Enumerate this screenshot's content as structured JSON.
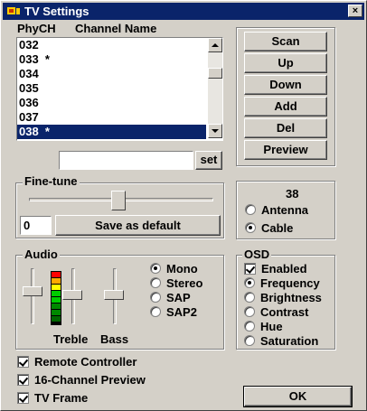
{
  "window": {
    "title": "TV Settings",
    "close": "×"
  },
  "channels": {
    "headers": {
      "phy": "PhyCH",
      "name": "Channel Name"
    },
    "items": [
      "032",
      "033  *",
      "034",
      "035",
      "036",
      "037",
      "038  *"
    ],
    "selected_index": 6,
    "name_input": "",
    "set_label": "set"
  },
  "actions": {
    "scan": "Scan",
    "up": "Up",
    "down": "Down",
    "add": "Add",
    "del": "Del",
    "preview": "Preview"
  },
  "finetune": {
    "legend": "Fine-tune",
    "value": "0",
    "save_default": "Save as default"
  },
  "source": {
    "channel": "38",
    "antenna": "Antenna",
    "cable": "Cable",
    "selected": "Cable"
  },
  "audio": {
    "legend": "Audio",
    "treble": "Treble",
    "bass": "Bass",
    "modes": [
      "Mono",
      "Stereo",
      "SAP",
      "SAP2"
    ],
    "selected_mode": "Mono",
    "meter_colors": [
      "#ff0000",
      "#ffaa00",
      "#ffff00",
      "#00cc00",
      "#00cc00",
      "#008800",
      "#008800",
      "#006600"
    ]
  },
  "osd": {
    "legend": "OSD",
    "enabled": "Enabled",
    "enabled_checked": true,
    "options": [
      "Frequency",
      "Brightness",
      "Contrast",
      "Hue",
      "Saturation"
    ],
    "selected": "Frequency"
  },
  "options": {
    "remote": "Remote Controller",
    "preview16": "16-Channel Preview",
    "tvframe": "TV Frame",
    "remote_checked": true,
    "preview16_checked": true,
    "tvframe_checked": true
  },
  "ok_label": "OK"
}
